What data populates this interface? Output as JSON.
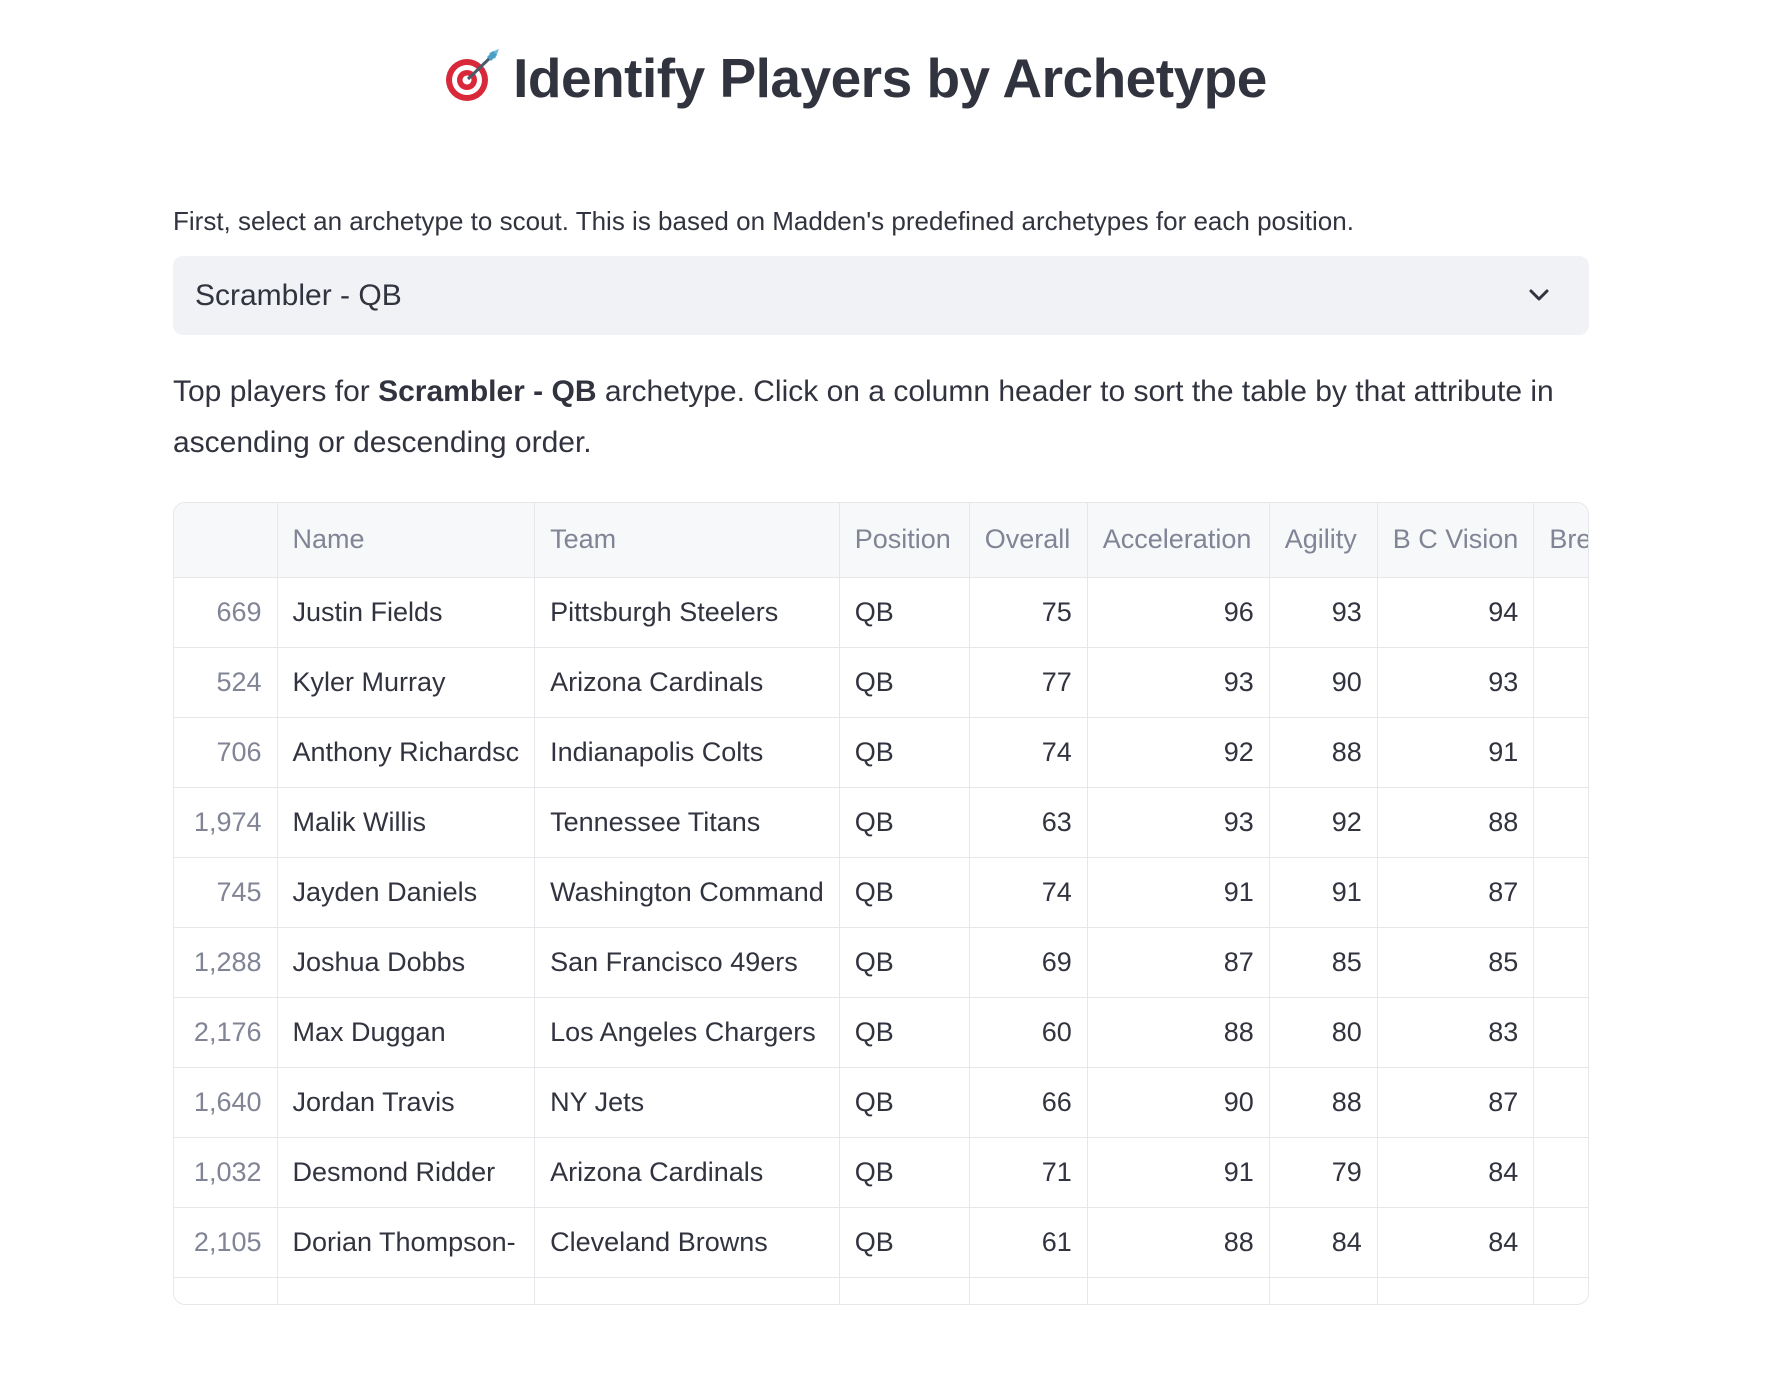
{
  "page": {
    "title": "Identify Players by Archetype",
    "title_icon": "dart-target-icon"
  },
  "instruction": "First, select an archetype to scout. This is based on Madden's predefined archetypes for each position.",
  "archetype_select": {
    "value": "Scrambler - QB",
    "icon": "chevron-down-icon"
  },
  "description": {
    "prefix": "Top players for ",
    "archetype": "Scrambler - QB",
    "suffix": " archetype. Click on a column header to sort the table by that attribute in ascending or descending order."
  },
  "table": {
    "columns": [
      "",
      "Name",
      "Team",
      "Position",
      "Overall",
      "Acceleration",
      "Agility",
      "B C Vision",
      "Break Sa"
    ],
    "rows": [
      {
        "index": "669",
        "name": "Justin Fields",
        "team": "Pittsburgh Steelers",
        "position": "QB",
        "overall": "75",
        "acceleration": "96",
        "agility": "93",
        "bc_vision": "94",
        "break_sack": ""
      },
      {
        "index": "524",
        "name": "Kyler Murray",
        "team": "Arizona Cardinals",
        "position": "QB",
        "overall": "77",
        "acceleration": "93",
        "agility": "90",
        "bc_vision": "93",
        "break_sack": ""
      },
      {
        "index": "706",
        "name": "Anthony Richardsc",
        "team": "Indianapolis Colts",
        "position": "QB",
        "overall": "74",
        "acceleration": "92",
        "agility": "88",
        "bc_vision": "91",
        "break_sack": ""
      },
      {
        "index": "1,974",
        "name": "Malik Willis",
        "team": "Tennessee Titans",
        "position": "QB",
        "overall": "63",
        "acceleration": "93",
        "agility": "92",
        "bc_vision": "88",
        "break_sack": ""
      },
      {
        "index": "745",
        "name": "Jayden Daniels",
        "team": "Washington Command",
        "position": "QB",
        "overall": "74",
        "acceleration": "91",
        "agility": "91",
        "bc_vision": "87",
        "break_sack": ""
      },
      {
        "index": "1,288",
        "name": "Joshua Dobbs",
        "team": "San Francisco 49ers",
        "position": "QB",
        "overall": "69",
        "acceleration": "87",
        "agility": "85",
        "bc_vision": "85",
        "break_sack": ""
      },
      {
        "index": "2,176",
        "name": "Max Duggan",
        "team": "Los Angeles Chargers",
        "position": "QB",
        "overall": "60",
        "acceleration": "88",
        "agility": "80",
        "bc_vision": "83",
        "break_sack": ""
      },
      {
        "index": "1,640",
        "name": "Jordan Travis",
        "team": "NY Jets",
        "position": "QB",
        "overall": "66",
        "acceleration": "90",
        "agility": "88",
        "bc_vision": "87",
        "break_sack": ""
      },
      {
        "index": "1,032",
        "name": "Desmond Ridder",
        "team": "Arizona Cardinals",
        "position": "QB",
        "overall": "71",
        "acceleration": "91",
        "agility": "79",
        "bc_vision": "84",
        "break_sack": ""
      },
      {
        "index": "2,105",
        "name": "Dorian Thompson-",
        "team": "Cleveland Browns",
        "position": "QB",
        "overall": "61",
        "acceleration": "88",
        "agility": "84",
        "bc_vision": "84",
        "break_sack": ""
      }
    ]
  }
}
